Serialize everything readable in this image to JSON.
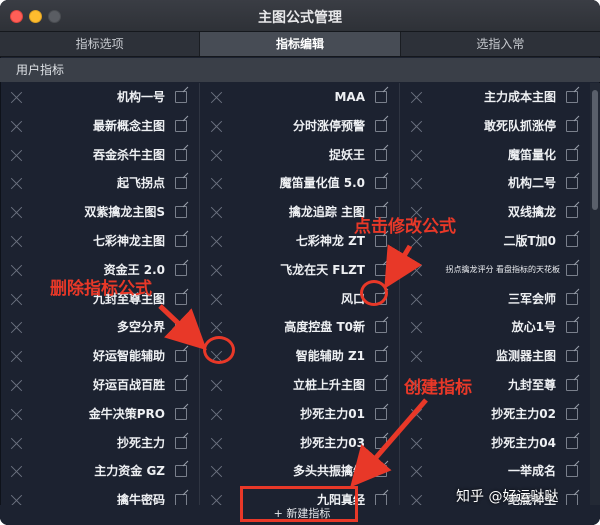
{
  "window": {
    "title": "主图公式管理"
  },
  "tabs": [
    {
      "label": "指标选项",
      "active": false
    },
    {
      "label": "指标编辑",
      "active": true
    },
    {
      "label": "选指入常",
      "active": false
    }
  ],
  "section": {
    "label": "用户指标"
  },
  "columns": [
    [
      "机构一号",
      "最新概念主图",
      "吞金杀牛主图",
      "起飞拐点",
      "双紫擒龙主图S",
      "七彩神龙主图",
      "资金王 2.0",
      "九封至尊主图",
      "多空分界",
      "好运智能辅助",
      "好运百战百胜",
      "金牛决策PRO",
      "抄死主力",
      "主力资金 GZ",
      "擒牛密码"
    ],
    [
      "MAA",
      "分时涨停预警",
      "捉妖王",
      "魔笛量化值 5.0",
      "擒龙追踪 主图",
      "七彩神龙 ZT",
      "飞龙在天 FLZT",
      "风口",
      "高度控盘 T0新",
      "智能辅助 Z1",
      "立桩上升主图",
      "抄死主力01",
      "抄死主力03",
      "多头共振擒牛",
      "九阳真经"
    ],
    [
      "主力成本主图",
      "敢死队抓涨停",
      "魔笛量化",
      "机构二号",
      "双线擒龙",
      "二版T加0",
      "拐点擒龙评分 看盘指标的天花板",
      "三军会师",
      "放心1号",
      "监测器主图",
      "九封至尊",
      "抄死主力02",
      "抄死主力04",
      "一举成名",
      "绝底神生"
    ]
  ],
  "bottom": {
    "new_label": "+ 新建指标"
  },
  "annotations": {
    "edit": "点击修改公式",
    "delete": "删除指标公式",
    "create": "创建指标"
  },
  "watermark": "知乎 @好运哒哒",
  "colors": {
    "annotation": "#e83828",
    "active_tab": "#474c55",
    "window_bg": "#1c2230"
  }
}
